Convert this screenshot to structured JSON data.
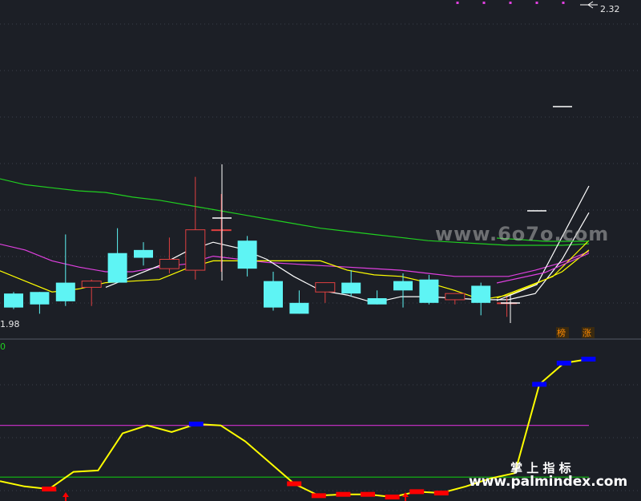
{
  "chart_data": {
    "type": "candlestick",
    "price_high_label": "2.32",
    "price_low_label": "1.98",
    "indicator_zero_label": "0",
    "tags": [
      "榜",
      "涨"
    ],
    "candles": [
      {
        "o": 2.003,
        "h": 2.004,
        "l": 1.993,
        "c": 1.994
      },
      {
        "o": 2.004,
        "h": 2.004,
        "l": 1.99,
        "c": 1.996
      },
      {
        "o": 2.01,
        "h": 2.041,
        "l": 1.995,
        "c": 1.998
      },
      {
        "o": 2.007,
        "h": 2.012,
        "l": 1.995,
        "c": 2.011
      },
      {
        "o": 2.029,
        "h": 2.045,
        "l": 2.013,
        "c": 2.01
      },
      {
        "o": 2.031,
        "h": 2.036,
        "l": 2.021,
        "c": 2.026
      },
      {
        "o": 2.019,
        "h": 2.039,
        "l": 2.016,
        "c": 2.025
      },
      {
        "o": 2.018,
        "h": 2.078,
        "l": 2.012,
        "c": 2.044
      },
      {
        "o": 2.044,
        "h": 2.067,
        "l": 2.017,
        "c": 2.044
      },
      {
        "o": 2.037,
        "h": 2.04,
        "l": 2.014,
        "c": 2.019
      },
      {
        "o": 2.011,
        "h": 2.017,
        "l": 1.992,
        "c": 1.994
      },
      {
        "o": 1.997,
        "h": 2.005,
        "l": 1.99,
        "c": 1.99
      },
      {
        "o": 2.004,
        "h": 2.008,
        "l": 1.997,
        "c": 2.01
      },
      {
        "o": 2.01,
        "h": 2.018,
        "l": 2.001,
        "c": 2.003
      },
      {
        "o": 2.0,
        "h": 2.005,
        "l": 1.996,
        "c": 1.996
      },
      {
        "o": 2.011,
        "h": 2.016,
        "l": 1.994,
        "c": 2.005
      },
      {
        "o": 2.012,
        "h": 2.015,
        "l": 1.996,
        "c": 1.997
      },
      {
        "o": 1.999,
        "h": 2.003,
        "l": 1.996,
        "c": 2.003
      },
      {
        "o": 2.008,
        "h": 2.01,
        "l": 1.989,
        "c": 1.997
      },
      {
        "o": 1.997,
        "h": 2.002,
        "l": 1.988,
        "c": 1.997
      }
    ],
    "ma_fast": [
      null,
      null,
      null,
      null,
      2.007,
      2.014,
      2.021,
      2.03,
      2.036,
      2.032,
      2.025,
      2.014,
      2.005,
      2.002,
      1.997,
      2.001,
      2.001,
      2.0,
      1.999,
      1.999,
      2.003,
      2.025,
      2.055
    ],
    "ma_mid": [
      2.018,
      2.011,
      2.004,
      2.006,
      2.01,
      2.011,
      2.012,
      2.019,
      2.024,
      2.024,
      2.024,
      2.024,
      2.024,
      2.018,
      2.015,
      2.014,
      2.01,
      2.005,
      1.999,
      2.002,
      2.009,
      2.017,
      2.031
    ],
    "ma_slow": [
      2.035,
      2.031,
      2.024,
      2.02,
      2.017,
      2.017,
      2.02,
      2.022,
      2.027,
      2.025,
      2.023,
      2.022,
      2.021,
      2.02,
      2.019,
      2.018,
      2.016,
      2.014,
      2.014,
      2.014,
      2.018,
      2.023,
      2.03
    ],
    "ma_long": [
      2.077,
      2.073,
      2.071,
      2.069,
      2.068,
      2.065,
      2.063,
      2.06,
      2.057,
      2.054,
      2.051,
      2.048,
      2.045,
      2.043,
      2.041,
      2.039,
      2.037,
      2.036,
      2.035,
      2.034,
      2.034,
      2.034,
      2.035
    ],
    "indicator_line": [
      8,
      4,
      2,
      15,
      16,
      44,
      50,
      45,
      51,
      50,
      38,
      22,
      6,
      -3,
      -2,
      -2,
      -4,
      0,
      -1,
      4,
      10,
      14,
      81,
      97,
      100
    ],
    "indicator_upper": 50,
    "indicator_lower": 11,
    "bull_markers": [
      2,
      15,
      17
    ],
    "bear_markers": [
      8,
      22,
      23,
      24
    ]
  },
  "watermarks": {
    "url_top": "www.6o7o.com",
    "cn_title": "掌 上 指 标",
    "url_bottom": "www.palmindex.com"
  },
  "colors": {
    "background": "#1c1f26",
    "up": "#e04040",
    "down": "#5ef4f4",
    "ma_fast": "#ffffff",
    "ma_mid": "#ffff00",
    "ma_slow": "#e040e0",
    "ma_long": "#20d020",
    "indicator": "#ffff00",
    "upper_line": "#d030d0",
    "lower_line": "#10c010",
    "bull_marker": "#ff0000",
    "bear_marker": "#0000ff"
  }
}
